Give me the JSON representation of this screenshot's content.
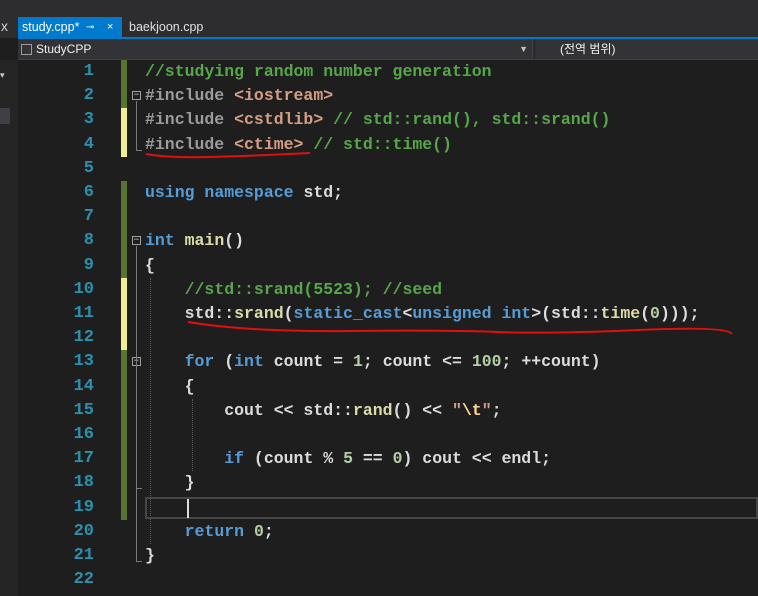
{
  "tabs": [
    {
      "label": "study.cpp*",
      "pin": "⊸",
      "close": "×"
    },
    {
      "label": "baekjoon.cpp"
    }
  ],
  "leftcut": {
    "top_glyph": "x",
    "mini_glyph": "▾"
  },
  "navbar": {
    "project": "StudyCPP",
    "scope": "(전역 범위)"
  },
  "editor": {
    "line_numbers": [
      "1",
      "2",
      "3",
      "4",
      "5",
      "6",
      "7",
      "8",
      "9",
      "10",
      "11",
      "12",
      "13",
      "14",
      "15",
      "16",
      "17",
      "18",
      "19",
      "20",
      "21",
      "22"
    ],
    "fold_markers": [
      {
        "line": 2,
        "symbol": "−"
      },
      {
        "line": 8,
        "symbol": "−"
      },
      {
        "line": 13,
        "symbol": "−"
      }
    ],
    "change_markers": {
      "saved_lines": [
        1,
        2,
        3,
        4,
        6,
        7,
        8,
        9,
        13,
        14,
        15,
        16,
        17,
        18,
        19
      ],
      "unsaved_lines": [
        3,
        4,
        10,
        11,
        12
      ],
      "saved_color": "#577430",
      "unsaved_color": "#efef91"
    },
    "current_line": 19,
    "annotations": [
      {
        "type": "red-underline",
        "line": 4,
        "color": "#e01010"
      },
      {
        "type": "red-underline",
        "line": 11,
        "color": "#e01010"
      }
    ],
    "code_lines": [
      [
        {
          "t": "//studying random number generation",
          "c": "c-comment"
        }
      ],
      [
        {
          "t": "#include ",
          "c": "c-pre"
        },
        {
          "t": "<iostream>",
          "c": "c-inc"
        }
      ],
      [
        {
          "t": "#include ",
          "c": "c-pre"
        },
        {
          "t": "<cstdlib>",
          "c": "c-inc"
        },
        {
          "t": " // std::rand(), std::srand()",
          "c": "c-comment"
        }
      ],
      [
        {
          "t": "#include ",
          "c": "c-pre"
        },
        {
          "t": "<ctime>",
          "c": "c-inc"
        },
        {
          "t": " // std::time()",
          "c": "c-comment"
        }
      ],
      [],
      [
        {
          "t": "using",
          "c": "c-kw"
        },
        {
          "t": " "
        },
        {
          "t": "namespace",
          "c": "c-kw"
        },
        {
          "t": " std;"
        }
      ],
      [],
      [
        {
          "t": "int",
          "c": "c-kw"
        },
        {
          "t": " "
        },
        {
          "t": "main",
          "c": "c-fn"
        },
        {
          "t": "()"
        }
      ],
      [
        {
          "t": "{"
        }
      ],
      [
        {
          "t": "    "
        },
        {
          "t": "//std::srand(5523); //seed",
          "c": "c-comment"
        }
      ],
      [
        {
          "t": "    std::"
        },
        {
          "t": "srand",
          "c": "c-fn"
        },
        {
          "t": "("
        },
        {
          "t": "static_cast",
          "c": "c-kw"
        },
        {
          "t": "<"
        },
        {
          "t": "unsigned",
          "c": "c-kw"
        },
        {
          "t": " "
        },
        {
          "t": "int",
          "c": "c-kw"
        },
        {
          "t": ">(std::"
        },
        {
          "t": "time",
          "c": "c-fn"
        },
        {
          "t": "("
        },
        {
          "t": "0",
          "c": "c-num"
        },
        {
          "t": ")));"
        }
      ],
      [],
      [
        {
          "t": "    "
        },
        {
          "t": "for",
          "c": "c-kw"
        },
        {
          "t": " ("
        },
        {
          "t": "int",
          "c": "c-kw"
        },
        {
          "t": " count = "
        },
        {
          "t": "1",
          "c": "c-num"
        },
        {
          "t": "; count <= "
        },
        {
          "t": "100",
          "c": "c-num"
        },
        {
          "t": "; ++count)"
        }
      ],
      [
        {
          "t": "    {"
        }
      ],
      [
        {
          "t": "        cout << std::"
        },
        {
          "t": "rand",
          "c": "c-fn"
        },
        {
          "t": "() << "
        },
        {
          "t": "\"",
          "c": "c-str"
        },
        {
          "t": "\\t",
          "c": "c-esc"
        },
        {
          "t": "\"",
          "c": "c-str"
        },
        {
          "t": ";"
        }
      ],
      [],
      [
        {
          "t": "        "
        },
        {
          "t": "if",
          "c": "c-kw"
        },
        {
          "t": " (count % "
        },
        {
          "t": "5",
          "c": "c-num"
        },
        {
          "t": " == "
        },
        {
          "t": "0",
          "c": "c-num"
        },
        {
          "t": ") cout << endl;"
        }
      ],
      [
        {
          "t": "    }"
        }
      ],
      [],
      [
        {
          "t": "    "
        },
        {
          "t": "return",
          "c": "c-kw"
        },
        {
          "t": " "
        },
        {
          "t": "0",
          "c": "c-num"
        },
        {
          "t": ";"
        }
      ],
      [
        {
          "t": "}"
        }
      ],
      []
    ]
  }
}
